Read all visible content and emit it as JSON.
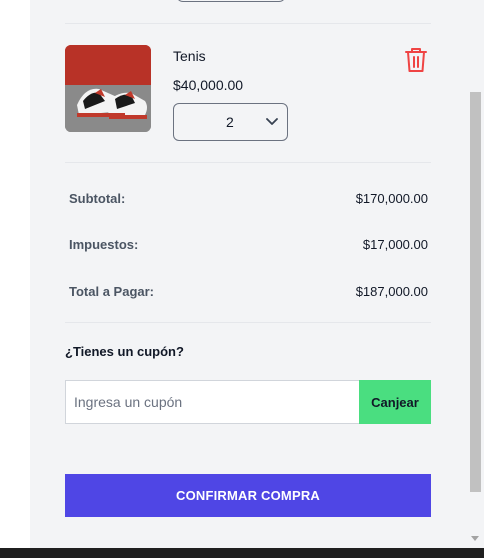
{
  "cart": {
    "item": {
      "name": "Tenis",
      "price": "$40,000.00",
      "quantity": "2",
      "image_alt": "sneaker-photo"
    }
  },
  "summary": {
    "subtotal_label": "Subtotal:",
    "subtotal_value": "$170,000.00",
    "tax_label": "Impuestos:",
    "tax_value": "$17,000.00",
    "total_label": "Total a Pagar:",
    "total_value": "$187,000.00"
  },
  "coupon": {
    "title": "¿Tienes un cupón?",
    "placeholder": "Ingresa un cupón",
    "button_label": "Canjear"
  },
  "checkout": {
    "confirm_label": "CONFIRMAR COMPRA"
  },
  "colors": {
    "confirm_bg": "#4f46e5",
    "coupon_bg": "#4ade80",
    "trash_red": "#ef4444"
  },
  "icons": {
    "delete": "trash-icon",
    "quantity": "chevron-down-icon"
  }
}
